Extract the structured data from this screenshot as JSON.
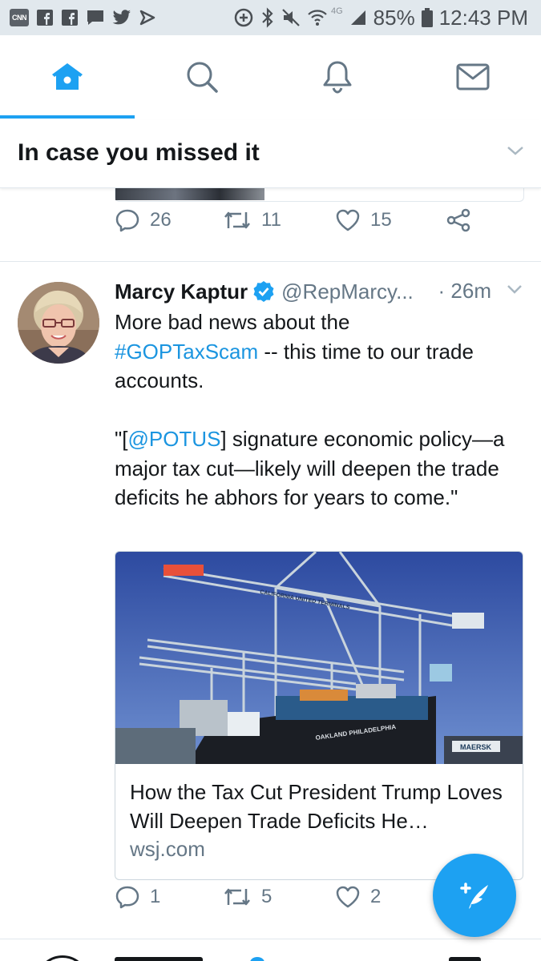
{
  "status_bar": {
    "cnn_label": "CNN",
    "network_label": "4G",
    "battery": "85%",
    "time": "12:43 PM"
  },
  "tabs": [
    {
      "icon": "home-icon",
      "active": true
    },
    {
      "icon": "search-icon",
      "active": false
    },
    {
      "icon": "bell-icon",
      "active": false
    },
    {
      "icon": "mail-icon",
      "active": false
    }
  ],
  "header": {
    "title": "In case you missed it"
  },
  "previous_tweet": {
    "replies": "26",
    "retweets": "11",
    "likes": "15"
  },
  "tweet": {
    "name": "Marcy Kaptur",
    "handle": "@RepMarcy...",
    "time": "· 26m",
    "text_line1": "More bad news about the",
    "hashtag": "#GOPTaxScam",
    "text_line2_rest": " -- this time to our trade accounts.",
    "quote_open": "\"[",
    "mention": "@POTUS",
    "quote_rest": "] signature economic policy—a major tax cut—likely will deepen the trade deficits he abhors for years to come.\"",
    "card": {
      "title": "How the Tax Cut President Trump Loves Will Deepen Trade Deficits He…",
      "domain": "wsj.com",
      "image_ship_text": "OAKLAND PHILADELPHIA",
      "image_crane_text": "CALIFORNIA UNITED TERMINALS",
      "image_maersk": "MAERSK"
    },
    "replies": "1",
    "retweets": "5",
    "likes": "2"
  },
  "colors": {
    "accent": "#1da1f2",
    "link": "#1b95e0",
    "muted": "#657786"
  }
}
